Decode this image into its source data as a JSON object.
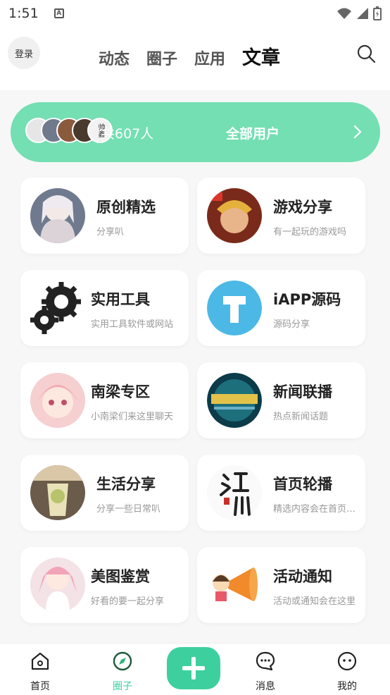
{
  "status_bar": {
    "time": "1:51",
    "notif_letter": "A"
  },
  "header": {
    "login_label": "登录",
    "tabs": [
      {
        "label": "动态",
        "active": false
      },
      {
        "label": "圈子",
        "active": false
      },
      {
        "label": "应用",
        "active": false
      },
      {
        "label": "文章",
        "active": true
      }
    ]
  },
  "users_bar": {
    "count_text": "共607人",
    "all_users_label": "全部用户",
    "avatar_badge": "帅鑫",
    "accent_color": "#73dfb2"
  },
  "cards": [
    {
      "title": "原创精选",
      "desc": "分享叭",
      "icon": "anime-girl-avatar"
    },
    {
      "title": "游戏分享",
      "desc": "有一起玩的游戏吗",
      "icon": "game-hero-avatar"
    },
    {
      "title": "实用工具",
      "desc": "实用工具软件或网站",
      "icon": "gears-icon"
    },
    {
      "title": "iAPP源码",
      "desc": "源码分享",
      "icon": "iapp-logo-icon"
    },
    {
      "title": "南梁专区",
      "desc": "小南梁们来这里聊天",
      "icon": "pink-girl-avatar"
    },
    {
      "title": "新闻联播",
      "desc": "热点新闻话题",
      "icon": "news-logo-avatar"
    },
    {
      "title": "生活分享",
      "desc": "分享一些日常叭",
      "icon": "drink-photo-avatar"
    },
    {
      "title": "首页轮播",
      "desc": "精选内容会在首页轮播",
      "icon": "calligraphy-avatar"
    },
    {
      "title": "美图鉴赏",
      "desc": "好看的要一起分享",
      "icon": "anime-pink-avatar"
    },
    {
      "title": "活动通知",
      "desc": "活动或通知会在这里",
      "icon": "megaphone-girl-avatar"
    }
  ],
  "fab": {
    "icon": "plus-icon"
  },
  "bottom_nav": [
    {
      "label": "首页",
      "icon": "home-icon",
      "active": false
    },
    {
      "label": "圈子",
      "icon": "compass-icon",
      "active": true
    },
    {
      "label": "消息",
      "icon": "chat-icon",
      "active": false
    },
    {
      "label": "我的",
      "icon": "face-icon",
      "active": false
    }
  ],
  "colors": {
    "accent": "#3ecf9f",
    "nav_active": "#3ccf9f"
  }
}
